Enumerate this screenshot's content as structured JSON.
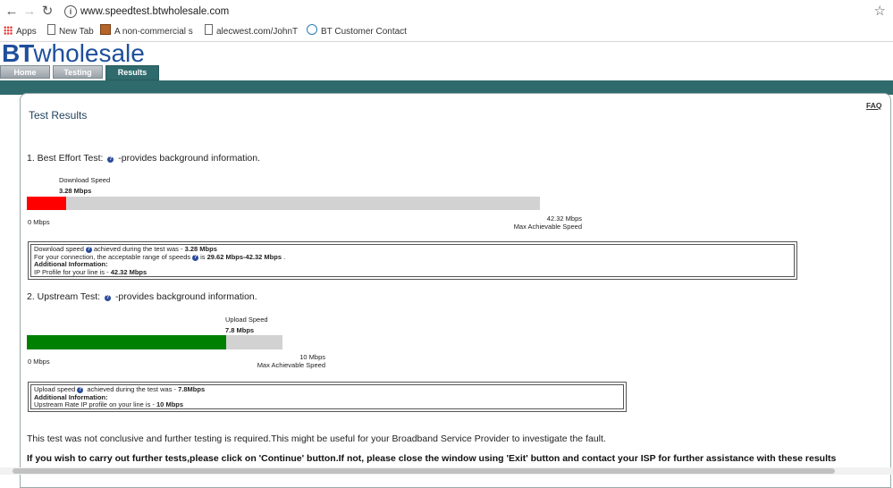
{
  "browser": {
    "url": "www.speedtest.btwholesale.com",
    "bookmarks": [
      {
        "label": "Apps",
        "icon": "apps-grid-icon"
      },
      {
        "label": "New Tab",
        "icon": "page-icon"
      },
      {
        "label": "A non-commercial se",
        "icon": "image-icon"
      },
      {
        "label": "alecwest.com/JohnTit",
        "icon": "page-icon"
      },
      {
        "label": "BT Customer Contact",
        "icon": "chat-icon"
      }
    ]
  },
  "header": {
    "logo_bt": "BT",
    "logo_wholesale": "wholesale",
    "tabs": [
      "Home",
      "Testing",
      "Results"
    ],
    "active_tab": "Results"
  },
  "page": {
    "title": "Test Results",
    "faq": "FAQ"
  },
  "download": {
    "section_title": "1. Best Effort Test:",
    "section_suffix": "-provides background information.",
    "label": "Download Speed",
    "value": "3.28 Mbps",
    "fill_fraction": 0.0775,
    "fill_color": "#ff0000",
    "min_label": "0 Mbps",
    "max_value": "42.32 Mbps",
    "max_label": "Max Achievable Speed",
    "info": {
      "l1a": "Download speed",
      "l1b": "achieved during the test was - ",
      "l1c": "3.28 Mbps",
      "l2a": "For your connection, the acceptable range of speeds",
      "l2b": "is ",
      "l2c": "29.62 Mbps-42.32 Mbps",
      "l2d": " .",
      "l3": "Additional Information:",
      "l4a": "IP Profile for your line is - ",
      "l4b": "42.32 Mbps"
    }
  },
  "upload": {
    "section_title": "2. Upstream Test:",
    "section_suffix": "-provides background information.",
    "label": "Upload Speed",
    "value": "7.8 Mbps",
    "fill_fraction": 0.78,
    "fill_color": "#008000",
    "min_label": "0 Mbps",
    "max_value": "10 Mbps",
    "max_label": "Max Achievable Speed",
    "info": {
      "l1a": "Upload speed",
      "l1b": " achieved during the test was - ",
      "l1c": "7.8Mbps",
      "l2": "Additional Information:",
      "l3a": "Upstream Rate IP profile on your line is - ",
      "l3b": "10 Mbps"
    }
  },
  "footer": {
    "note": "This test was not conclusive and further testing is required.This might be useful for your Broadband Service Provider to investigate the fault.",
    "instructions": "If you wish to carry out further tests,please click on 'Continue' button.If not, please close the window using 'Exit' button and contact your ISP for further assistance with these results"
  }
}
